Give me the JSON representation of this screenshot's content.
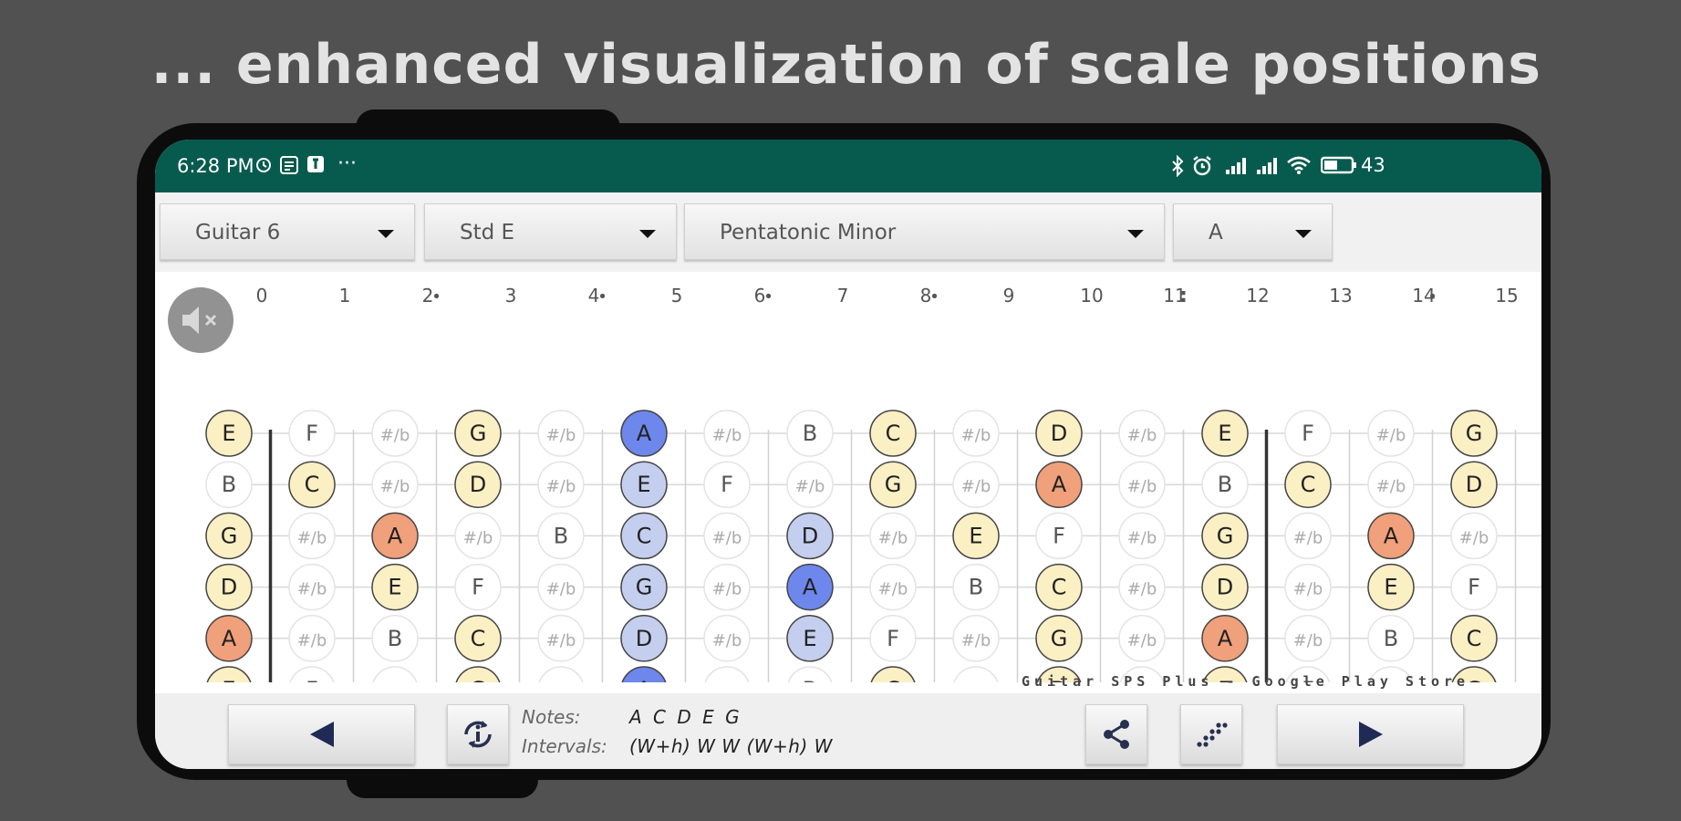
{
  "headline": "... enhanced visualization of scale positions",
  "status_bar": {
    "time": "6:28 PM",
    "more": "···",
    "battery": "43"
  },
  "spinners": [
    {
      "id": "instrument",
      "value": "Guitar 6"
    },
    {
      "id": "tuning",
      "value": "Std E"
    },
    {
      "id": "scale",
      "value": "Pentatonic Minor"
    },
    {
      "id": "key",
      "value": "A"
    }
  ],
  "fretboard": {
    "fret_numbers": [
      "0",
      "1",
      "2",
      "3",
      "4",
      "5",
      "6",
      "7",
      "8",
      "9",
      "10",
      "11",
      "12",
      "13",
      "14",
      "15"
    ],
    "marker_dot": "•",
    "double_marker": ":",
    "sharp_flat": "#/b",
    "strings": [
      [
        "E",
        "F",
        "#/b",
        "G",
        "#/b",
        "A",
        "#/b",
        "B",
        "C",
        "#/b",
        "D",
        "#/b",
        "E",
        "F",
        "#/b",
        "G"
      ],
      [
        "B",
        "C",
        "#/b",
        "D",
        "#/b",
        "E",
        "F",
        "#/b",
        "G",
        "#/b",
        "A",
        "#/b",
        "B",
        "C",
        "#/b",
        "D"
      ],
      [
        "G",
        "#/b",
        "A",
        "#/b",
        "B",
        "C",
        "#/b",
        "D",
        "#/b",
        "E",
        "F",
        "#/b",
        "G",
        "#/b",
        "A",
        "#/b"
      ],
      [
        "D",
        "#/b",
        "E",
        "F",
        "#/b",
        "G",
        "#/b",
        "A",
        "#/b",
        "B",
        "C",
        "#/b",
        "D",
        "#/b",
        "E",
        "F"
      ],
      [
        "A",
        "#/b",
        "B",
        "C",
        "#/b",
        "D",
        "#/b",
        "E",
        "F",
        "#/b",
        "G",
        "#/b",
        "A",
        "#/b",
        "B",
        "C"
      ],
      [
        "E",
        "F",
        "#/b",
        "G",
        "#/b",
        "A",
        "#/b",
        "B",
        "C",
        "#/b",
        "D",
        "#/b",
        "E",
        "F",
        "#/b",
        "G"
      ]
    ],
    "highlight_column_tonic": 5,
    "highlight_columns_position": [
      4,
      5,
      6,
      7
    ],
    "watermark": "Guitar SPS Plus  -  Google Play Store"
  },
  "note_colors": {
    "root": "#f0a07a",
    "scale": "#fbefc4",
    "position": "#c4ceee",
    "position_root": "#6d87ec",
    "empty": "#ffffff"
  },
  "info": {
    "notes_label": "Notes:",
    "notes_value": "A C D E G",
    "intervals_label": "Intervals:",
    "intervals_value": "(W+h) W W (W+h) W"
  },
  "icons": {
    "mute": "speaker-muted-icon",
    "prev": "triangle-left-icon",
    "next": "triangle-right-icon",
    "refresh": "refresh-info-icon",
    "share": "share-icon",
    "pattern": "dots-pattern-icon"
  }
}
